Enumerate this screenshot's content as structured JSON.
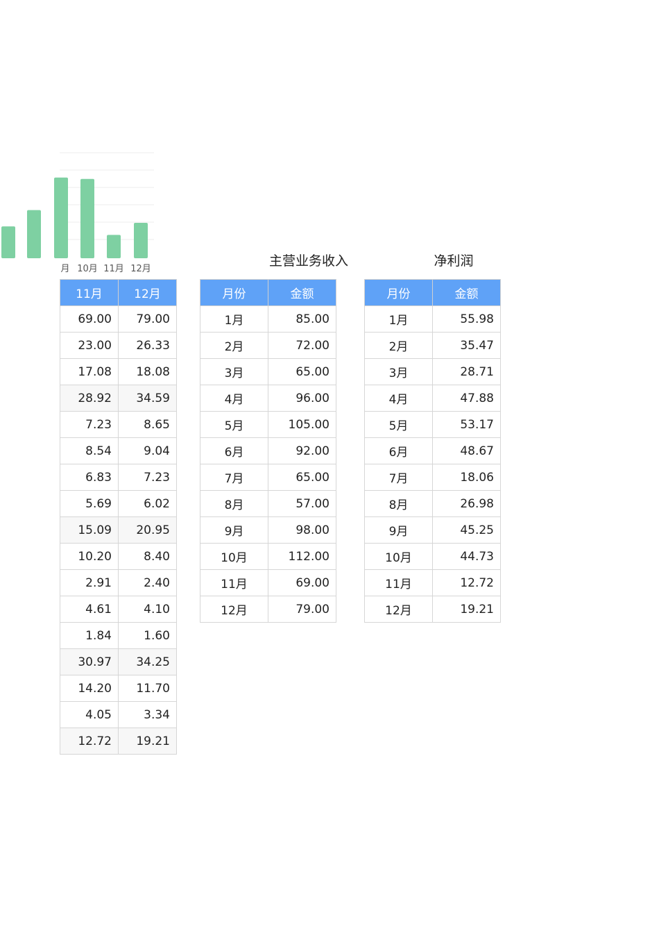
{
  "chart_data": {
    "type": "bar",
    "categories": [
      "",
      "",
      "月",
      "10月",
      "11月",
      "12月"
    ],
    "values": [
      45,
      68,
      114,
      112,
      33,
      50
    ],
    "color": "#7ed0a2",
    "grid": true
  },
  "left_table": {
    "headers": [
      "11月",
      "12月"
    ],
    "rows": [
      [
        "69.00",
        "79.00"
      ],
      [
        "23.00",
        "26.33"
      ],
      [
        "17.08",
        "18.08"
      ],
      [
        "28.92",
        "34.59"
      ],
      [
        "7.23",
        "8.65"
      ],
      [
        "8.54",
        "9.04"
      ],
      [
        "6.83",
        "7.23"
      ],
      [
        "5.69",
        "6.02"
      ],
      [
        "15.09",
        "20.95"
      ],
      [
        "10.20",
        "8.40"
      ],
      [
        "2.91",
        "2.40"
      ],
      [
        "4.61",
        "4.10"
      ],
      [
        "1.84",
        "1.60"
      ],
      [
        "30.97",
        "34.25"
      ],
      [
        "14.20",
        "11.70"
      ],
      [
        "4.05",
        "3.34"
      ],
      [
        "12.72",
        "19.21"
      ]
    ],
    "shaded_rows": [
      3,
      8,
      13,
      16
    ]
  },
  "revenue": {
    "title": "主营业务收入",
    "headers": [
      "月份",
      "金额"
    ],
    "rows": [
      [
        "1月",
        "85.00"
      ],
      [
        "2月",
        "72.00"
      ],
      [
        "3月",
        "65.00"
      ],
      [
        "4月",
        "96.00"
      ],
      [
        "5月",
        "105.00"
      ],
      [
        "6月",
        "92.00"
      ],
      [
        "7月",
        "65.00"
      ],
      [
        "8月",
        "57.00"
      ],
      [
        "9月",
        "98.00"
      ],
      [
        "10月",
        "112.00"
      ],
      [
        "11月",
        "69.00"
      ],
      [
        "12月",
        "79.00"
      ]
    ]
  },
  "profit": {
    "title": "净利润",
    "headers": [
      "月份",
      "金额"
    ],
    "rows": [
      [
        "1月",
        "55.98"
      ],
      [
        "2月",
        "35.47"
      ],
      [
        "3月",
        "28.71"
      ],
      [
        "4月",
        "47.88"
      ],
      [
        "5月",
        "53.17"
      ],
      [
        "6月",
        "48.67"
      ],
      [
        "7月",
        "18.06"
      ],
      [
        "8月",
        "26.98"
      ],
      [
        "9月",
        "45.25"
      ],
      [
        "10月",
        "44.73"
      ],
      [
        "11月",
        "12.72"
      ],
      [
        "12月",
        "19.21"
      ]
    ]
  }
}
